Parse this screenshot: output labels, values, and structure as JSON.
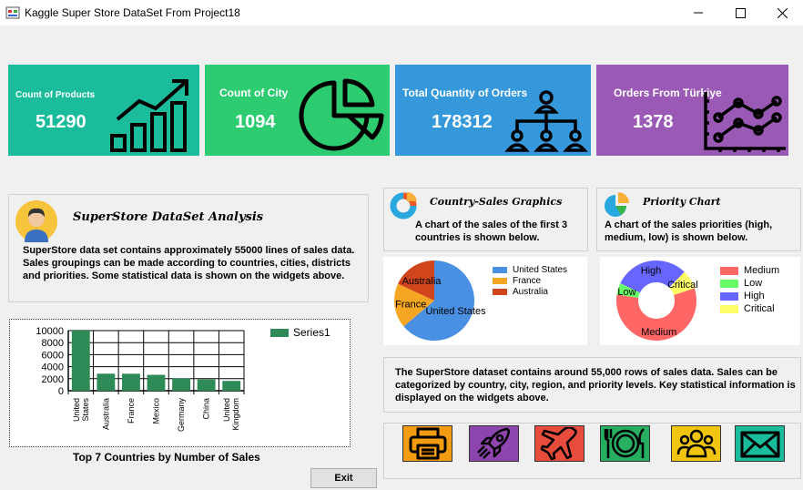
{
  "window": {
    "title": "Kaggle Super Store DataSet From Project18"
  },
  "tiles": [
    {
      "label": "Count of Products",
      "value": "51290",
      "color": "#1abc9c"
    },
    {
      "label": "Count of City",
      "value": "1094",
      "color": "#2ecc71"
    },
    {
      "label": "Total Quantity of Orders",
      "value": "178312",
      "color": "#3498db"
    },
    {
      "label": "Orders From Türkiye",
      "value": "1378",
      "color": "#9b59b6"
    }
  ],
  "analysis": {
    "title": "SuperStore DataSet Analysis",
    "text": "SuperStore data set contains approximately 55000 lines of sales data. Sales groupings can be made according to countries, cities, districts and priorities. Some statistical data is shown on the widgets above."
  },
  "country_sales": {
    "title": "Country-Sales Graphics",
    "description": "A chart of the sales of the first 3 countries is shown below."
  },
  "priority": {
    "title": "Priority Chart",
    "description": "A chart of the sales priorities (high, medium, low) is shown below."
  },
  "summary": {
    "text": "The SuperStore dataset contains around 55,000 rows of sales data. Sales can be categorized by country, city, region, and priority levels. Key statistical information is displayed on the widgets above."
  },
  "bar_caption": "Top 7 Countries by Number of Sales",
  "exit_label": "Exit",
  "icons": [
    "printer-icon",
    "rocket-icon",
    "airplane-icon",
    "dinner-plate-icon",
    "users-icon",
    "envelope-icon"
  ],
  "chart_data": [
    {
      "type": "bar",
      "categories": [
        "United States",
        "Australia",
        "France",
        "Mexico",
        "Germany",
        "China",
        "United Kingdom"
      ],
      "series": [
        {
          "name": "Series1",
          "values": [
            9994,
            2837,
            2827,
            2644,
            2065,
            1880,
            1633
          ],
          "color": "#2e8b57"
        }
      ],
      "ylim": [
        0,
        10000
      ],
      "yticks": [
        0,
        2000,
        4000,
        6000,
        8000,
        10000
      ],
      "grid": true,
      "legend": "top-right"
    },
    {
      "type": "pie",
      "categories": [
        "United States",
        "France",
        "Australia"
      ],
      "values": [
        9994,
        2827,
        2837
      ],
      "colors": [
        "#4a90e2",
        "#f5a623",
        "#d0451b"
      ],
      "legend": "right"
    },
    {
      "type": "pie",
      "categories": [
        "Medium",
        "Low",
        "High",
        "Critical"
      ],
      "values": [
        29433,
        2424,
        15501,
        3932
      ],
      "colors": [
        "#ff6666",
        "#66ff66",
        "#6666ff",
        "#ffff66"
      ],
      "legend": "right"
    }
  ]
}
